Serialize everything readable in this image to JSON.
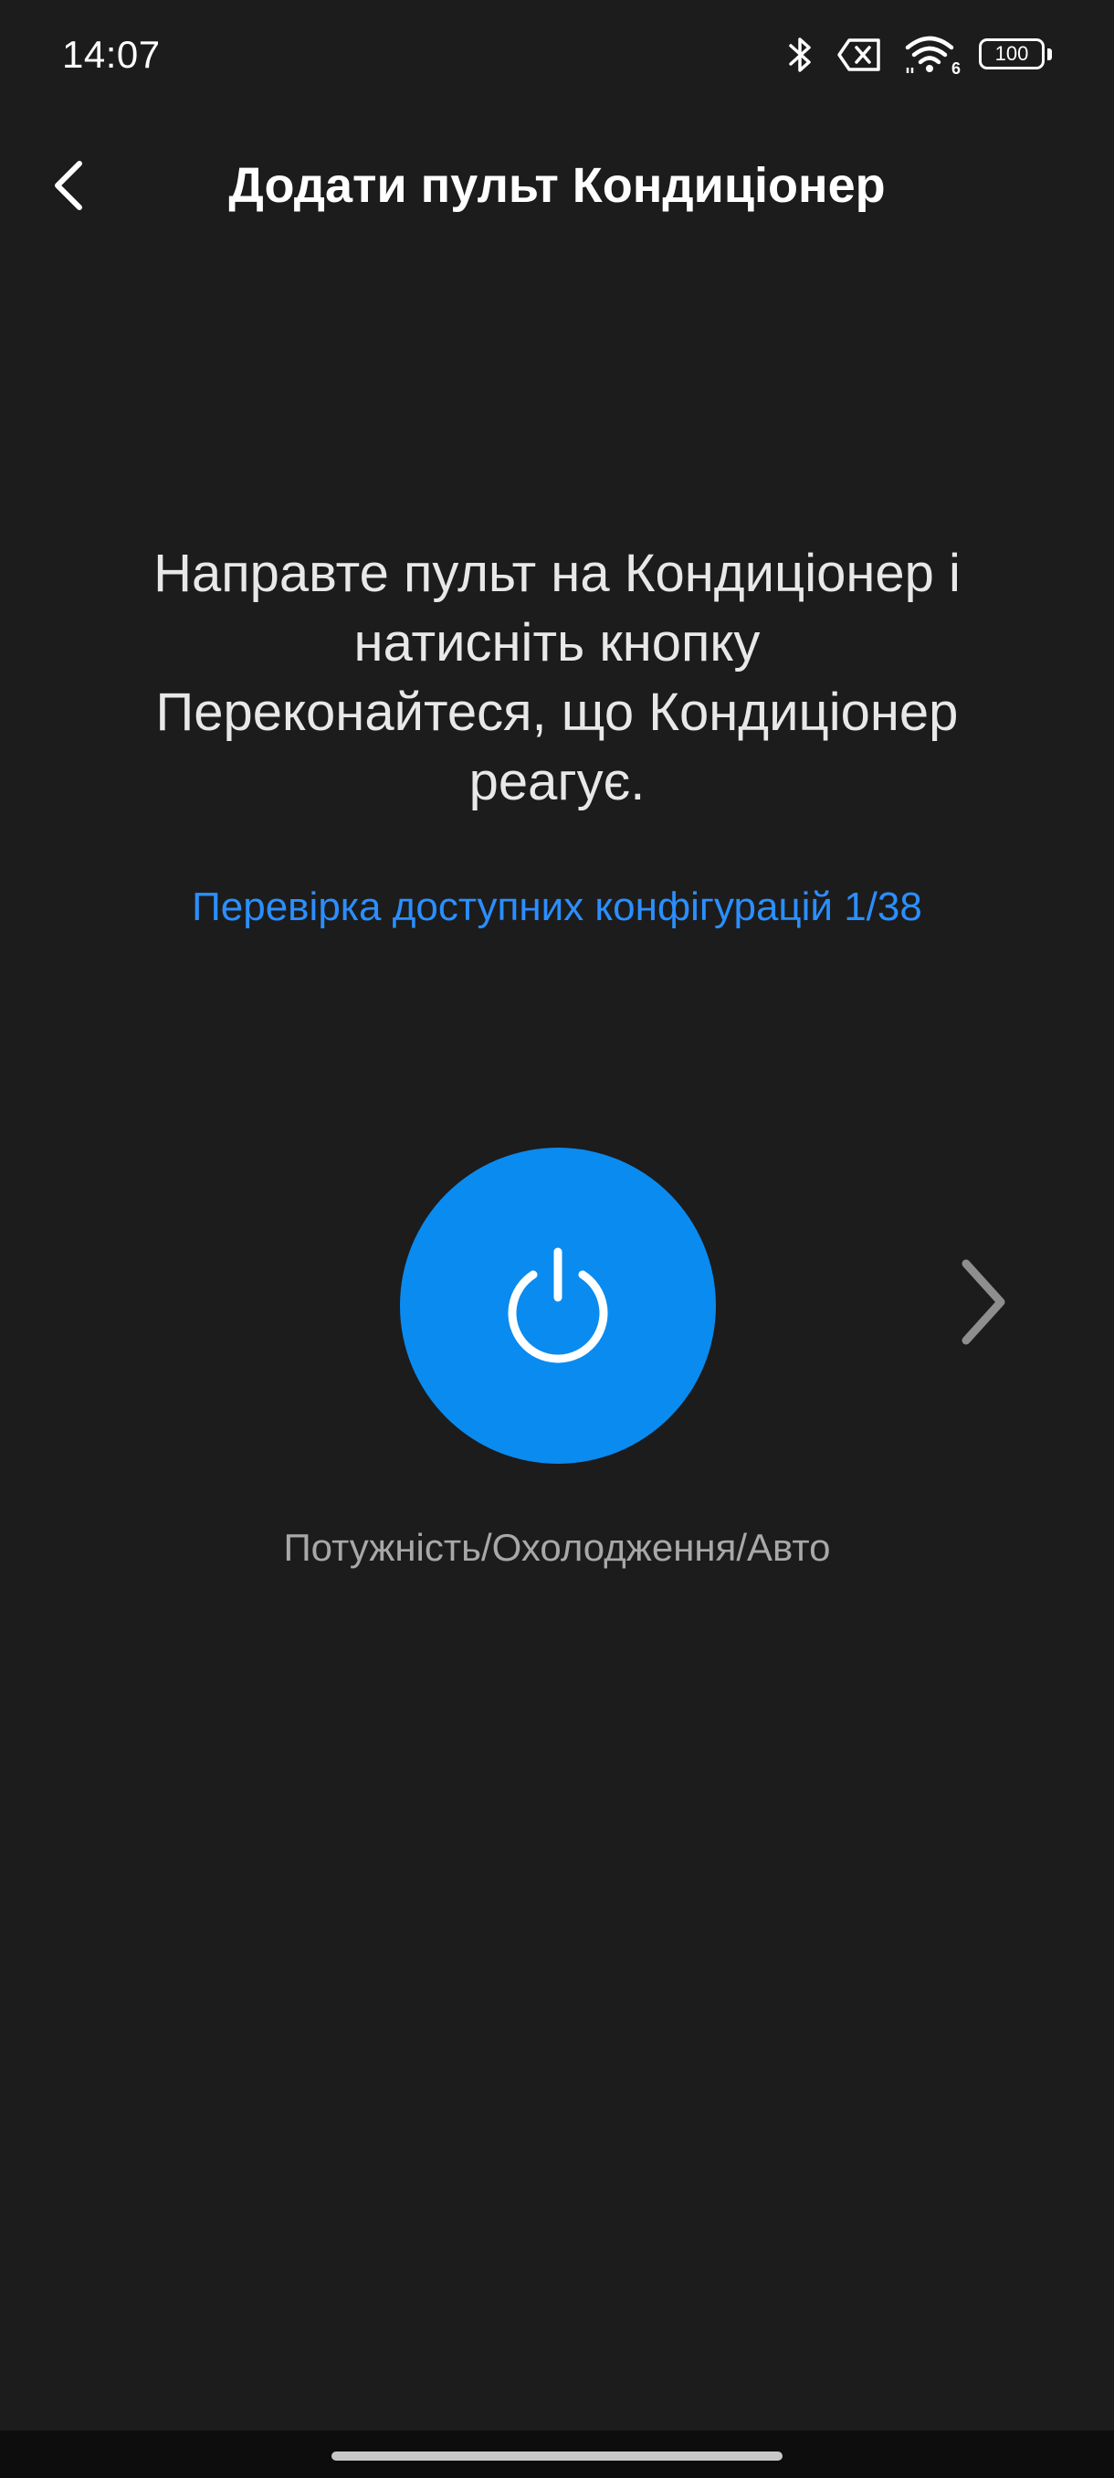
{
  "status_bar": {
    "time": "14:07",
    "battery_level": "100",
    "wifi_label": "6",
    "icons": [
      "bluetooth-icon",
      "sim-off-icon",
      "wifi-icon",
      "battery-icon"
    ]
  },
  "header": {
    "title": "Додати пульт Кондиціонер",
    "back_icon": "chevron-left-icon"
  },
  "instruction": {
    "lines": [
      "Направте пульт на Кондиціонер і",
      "натисніть кнопку",
      "Переконайтеся, що Кондиціонер",
      "реагує."
    ]
  },
  "progress": {
    "text": "Перевірка доступних конфігурацій 1/38"
  },
  "remote_button": {
    "icon": "power-icon",
    "label": "Потужність/Охолодження/Авто",
    "color": "#0a8bf0"
  },
  "next": {
    "icon": "chevron-right-icon"
  },
  "colors": {
    "background": "#1c1c1c",
    "accent": "#2b8fff",
    "muted_text": "#a8a8a8"
  }
}
